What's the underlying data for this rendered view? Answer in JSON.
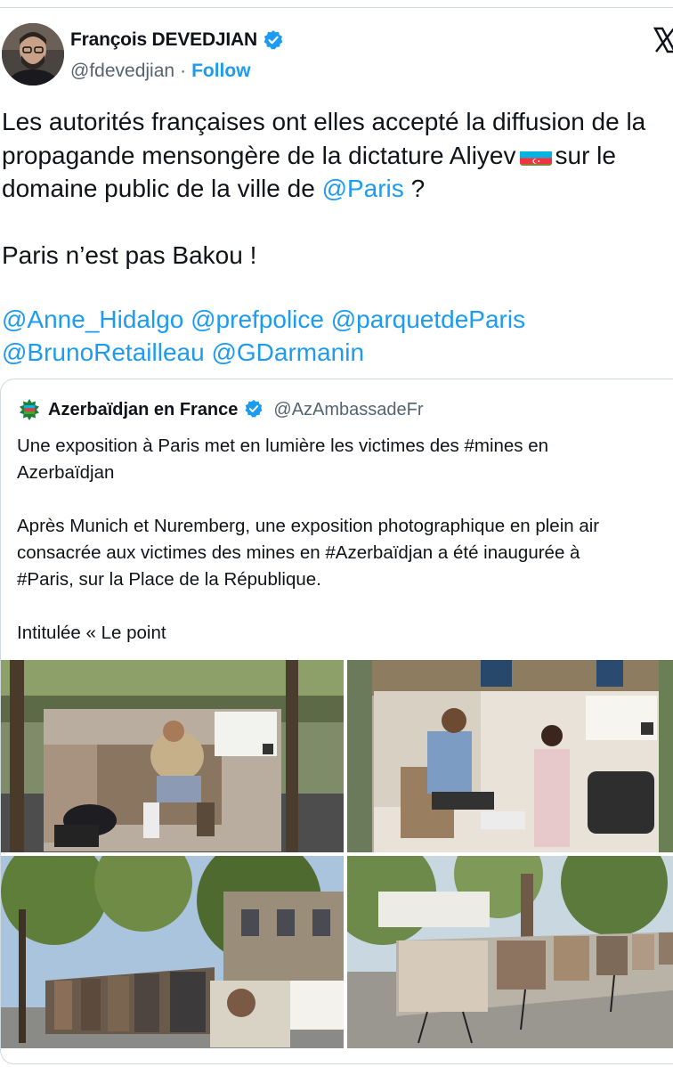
{
  "author": {
    "name": "François DEVEDJIAN",
    "handle": "@fdevedjian",
    "separator": "·",
    "follow_label": "Follow"
  },
  "platform_icon": "x-logo-icon",
  "tweet": {
    "line1": "Les autorités françaises ont elles accepté la diffusion de la",
    "line2_before_flag": "propagande mensongère de la dictature Aliyev",
    "line2_after_flag": "sur le",
    "line3_before": "domaine public de la ville de",
    "line3_mention": "@Paris",
    "line3_after": "?",
    "line4": "Paris n’est pas Bakou !",
    "mentions_line1": [
      "@Anne_Hidalgo",
      "@prefpolice",
      "@parquetdeParis"
    ],
    "mentions_line2": [
      "@BrunoRetailleau",
      "@GDarmanin"
    ],
    "flag_icon": "azerbaijan-flag-icon"
  },
  "quoted": {
    "name": "Azerbaïdjan en France",
    "handle": "@AzAmbassadeFr",
    "lines": [
      "Une exposition à Paris met en lumière les victimes des #mines en",
      "Azerbaïdjan",
      "",
      "Après Munich et Nuremberg, une exposition photographique en plein air",
      "consacrée aux victimes des mines en #Azerbaïdjan a été inaugurée à",
      "#Paris, sur la Place de la République.",
      "",
      "Intitulée « Le point"
    ],
    "photos": [
      "photo-exhibit-man-prosthesis",
      "photo-exhibit-girl-helping-man",
      "photo-exhibit-street-trees",
      "photo-exhibit-square-panels"
    ]
  },
  "colors": {
    "accent": "#1d9bf0",
    "text": "#0f1419",
    "secondary": "#536471",
    "border": "#cfd9de"
  }
}
